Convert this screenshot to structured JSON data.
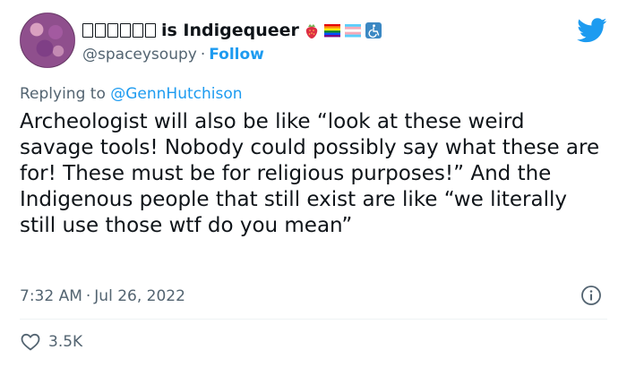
{
  "header": {
    "display_name": "is Indigequeer",
    "name_prefix_glyph_count": 6,
    "emojis": [
      "strawberry-emoji",
      "rainbow-flag-emoji",
      "transgender-flag-emoji",
      "wheelchair-emoji"
    ],
    "handle": "@spaceysoupy",
    "separator": "·",
    "follow_label": "Follow"
  },
  "reply": {
    "prefix": "Replying to",
    "mention": "@GennHutchison"
  },
  "tweet": {
    "text": "Archeologist will also be like “look at these weird savage tools! Nobody could possibly say what these are for! These must be for religious purposes!” And the Indigenous people that still exist are like “we literally still use those wtf do you mean”"
  },
  "meta": {
    "time": "7:32 AM",
    "separator": "·",
    "date": "Jul 26, 2022"
  },
  "stats": {
    "likes": "3.5K"
  },
  "colors": {
    "brand_blue": "#1d9bf0",
    "secondary_text": "#536471",
    "primary_text": "#0f1419"
  },
  "icons": {
    "brand": "twitter-bird-icon",
    "info": "info-icon",
    "like": "heart-icon"
  }
}
